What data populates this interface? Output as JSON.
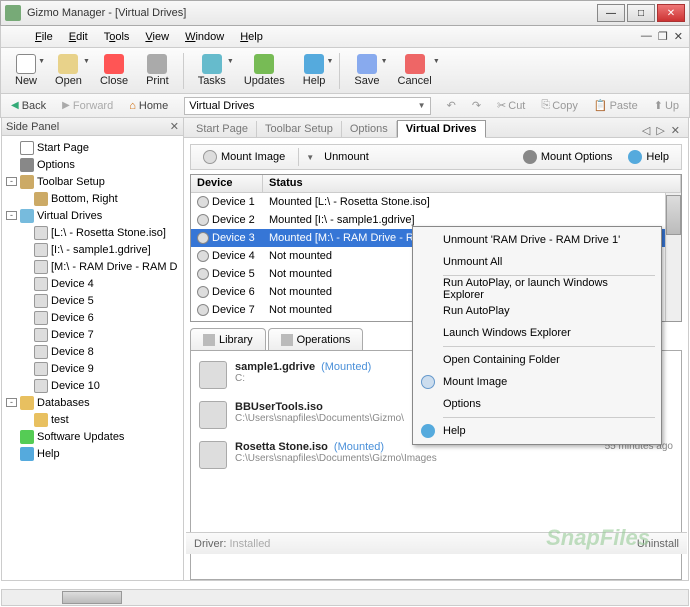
{
  "window": {
    "title": "Gizmo Manager - [Virtual Drives]"
  },
  "menu": {
    "file": "File",
    "edit": "Edit",
    "tools": "Tools",
    "view": "View",
    "window": "Window",
    "help": "Help"
  },
  "toolbar": {
    "new": "New",
    "open": "Open",
    "close": "Close",
    "print": "Print",
    "tasks": "Tasks",
    "updates": "Updates",
    "help": "Help",
    "save": "Save",
    "cancel": "Cancel"
  },
  "nav": {
    "back": "Back",
    "forward": "Forward",
    "home": "Home",
    "address": "Virtual Drives",
    "undo": "",
    "redo": "",
    "cut": "Cut",
    "copy": "Copy",
    "paste": "Paste",
    "up": "Up"
  },
  "sidepanel": {
    "title": "Side Panel",
    "items": {
      "start": "Start Page",
      "options": "Options",
      "toolbar": "Toolbar Setup",
      "bottomright": "Bottom, Right",
      "vdrives": "Virtual Drives",
      "d1": "[L:\\ - Rosetta Stone.iso]",
      "d2": "[I:\\ - sample1.gdrive]",
      "d3": "[M:\\ - RAM Drive - RAM D",
      "d4": "Device 4",
      "d5": "Device 5",
      "d6": "Device 6",
      "d7": "Device 7",
      "d8": "Device 8",
      "d9": "Device 9",
      "d10": "Device 10",
      "db": "Databases",
      "test": "test",
      "upd": "Software Updates",
      "help": "Help"
    }
  },
  "tabs": {
    "start": "Start Page",
    "toolbar": "Toolbar Setup",
    "options": "Options",
    "vdrives": "Virtual Drives"
  },
  "mountbar": {
    "mount": "Mount Image",
    "unmount": "Unmount",
    "options": "Mount Options",
    "help": "Help"
  },
  "devtable": {
    "cols": {
      "device": "Device",
      "status": "Status"
    },
    "rows": [
      {
        "dev": "Device 1",
        "stat": "Mounted [L:\\ - Rosetta Stone.iso]"
      },
      {
        "dev": "Device 2",
        "stat": "Mounted [I:\\ - sample1.gdrive]"
      },
      {
        "dev": "Device 3",
        "stat": "Mounted [M:\\ - RAM Drive - RAM Drive 1]"
      },
      {
        "dev": "Device 4",
        "stat": "Not mounted"
      },
      {
        "dev": "Device 5",
        "stat": "Not mounted"
      },
      {
        "dev": "Device 6",
        "stat": "Not mounted"
      },
      {
        "dev": "Device 7",
        "stat": "Not mounted"
      }
    ]
  },
  "ctx": {
    "unmount": "Unmount 'RAM Drive - RAM Drive 1'",
    "unmountall": "Unmount All",
    "autoplay": "Run AutoPlay, or launch Windows Explorer",
    "runautoplay": "Run AutoPlay",
    "explorer": "Launch Windows Explorer",
    "openfolder": "Open Containing Folder",
    "mount": "Mount Image",
    "options": "Options",
    "help": "Help"
  },
  "libtabs": {
    "library": "Library",
    "operations": "Operations"
  },
  "library": [
    {
      "name": "sample1.gdrive",
      "status": "(Mounted)",
      "path": "C:",
      "time": ""
    },
    {
      "name": "BBUserTools.iso",
      "status": "",
      "path": "C:\\Users\\snapfiles\\Documents\\Gizmo\\",
      "time": ""
    },
    {
      "name": "Rosetta Stone.iso",
      "status": "(Mounted)",
      "path": "C:\\Users\\snapfiles\\Documents\\Gizmo\\Images",
      "time": "55 minutes ago"
    }
  ],
  "status": {
    "driver_label": "Driver:",
    "driver_value": "Installed",
    "uninstall": "Uninstall"
  },
  "watermark": "SnapFiles"
}
